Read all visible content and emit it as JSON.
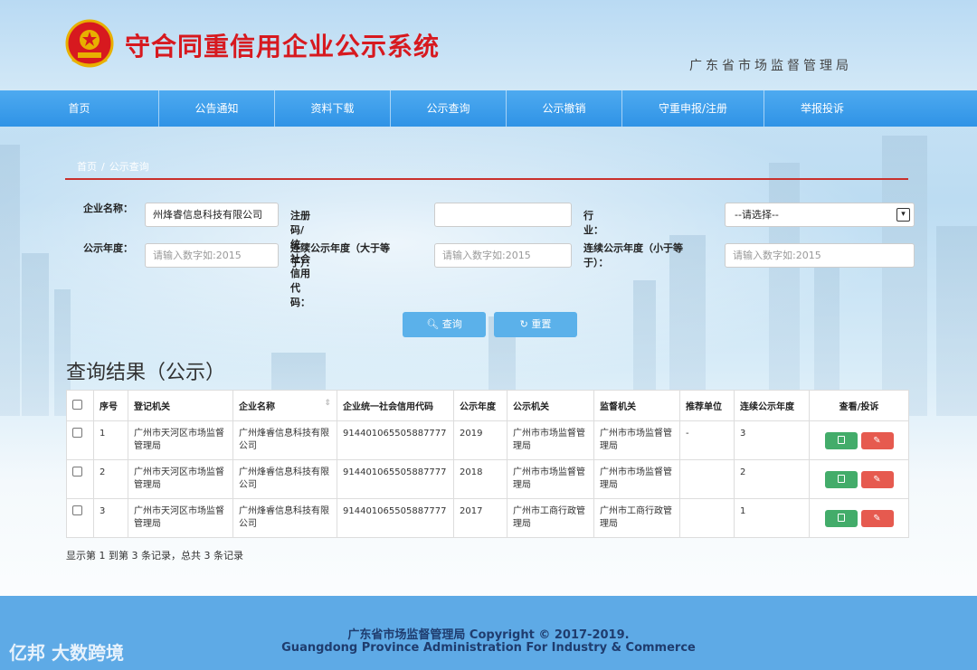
{
  "header": {
    "title": "守合同重信用企业公示系统",
    "agency": "广东省市场监督管理局"
  },
  "nav": [
    {
      "label": "首页"
    },
    {
      "label": "公告通知"
    },
    {
      "label": "资料下载"
    },
    {
      "label": "公示查询"
    },
    {
      "label": "公示撤销"
    },
    {
      "label": "守重申报/注册"
    },
    {
      "label": "举报投诉"
    }
  ],
  "breadcrumb": {
    "home": "首页",
    "sep": "/",
    "current": "公示查询"
  },
  "form": {
    "company_name_label": "企业名称：",
    "company_name_value": "州烽睿信息科技有限公司",
    "credit_code_label": "注册码/统一社会信用代码：",
    "credit_code_value": "",
    "industry_label": "行业：",
    "industry_value": "--请选择--",
    "year_label": "公示年度：",
    "year_placeholder": "请输入数字如:2015",
    "cont_gt_label": "连续公示年度（大于等于）：",
    "cont_gt_placeholder": "请输入数字如:2015",
    "cont_lt_label": "连续公示年度（小于等于）：",
    "cont_lt_placeholder": "请输入数字如:2015",
    "search_btn": "查询",
    "reset_btn": "重置"
  },
  "results": {
    "title": "查询结果（公示）",
    "columns": [
      "序号",
      "登记机关",
      "企业名称",
      "企业统一社会信用代码",
      "公示年度",
      "公示机关",
      "监督机关",
      "推荐单位",
      "连续公示年度",
      "查看/投诉"
    ],
    "rows": [
      {
        "no": "1",
        "reg": "广州市天河区市场监督管理局",
        "name": "广州烽睿信息科技有限公司",
        "code": "914401065505887777",
        "year": "2019",
        "pub": "广州市市场监督管理局",
        "sup": "广州市市场监督管理局",
        "rec": "-",
        "cont": "3"
      },
      {
        "no": "2",
        "reg": "广州市天河区市场监督管理局",
        "name": "广州烽睿信息科技有限公司",
        "code": "914401065505887777",
        "year": "2018",
        "pub": "广州市市场监督管理局",
        "sup": "广州市市场监督管理局",
        "rec": "",
        "cont": "2"
      },
      {
        "no": "3",
        "reg": "广州市天河区市场监督管理局",
        "name": "广州烽睿信息科技有限公司",
        "code": "914401065505887777",
        "year": "2017",
        "pub": "广州市工商行政管理局",
        "sup": "广州市工商行政管理局",
        "rec": "",
        "cont": "1"
      }
    ],
    "summary": "显示第 1 到第 3 条记录，总共 3 条记录"
  },
  "footer": {
    "line1": "广东省市场监督管理局 Copyright © 2017-2019.",
    "line2": "Guangdong Province Administration For Industry & Commerce"
  },
  "watermark": "亿邦 大数跨境",
  "colors": {
    "nav": "#2f93e6",
    "title_red": "#d7191f",
    "footer": "#5eaae6",
    "button": "#5bb1ea"
  }
}
